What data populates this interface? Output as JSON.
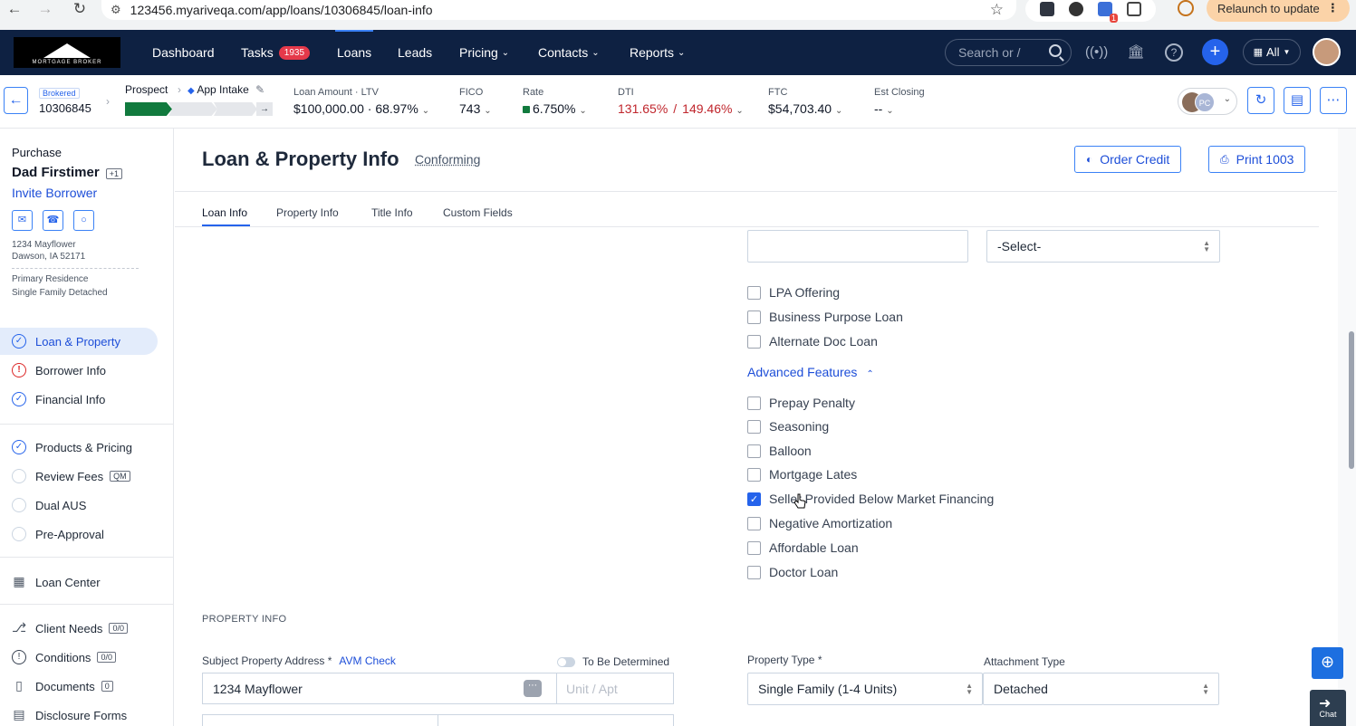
{
  "browser": {
    "url": "123456.myariveqa.com/app/loans/10306845/loan-info",
    "relaunch_label": "Relaunch to update",
    "ext_badge": "1"
  },
  "nav": {
    "logo_text": "MORTGAGE BROKER",
    "items": [
      {
        "label": "Dashboard"
      },
      {
        "label": "Tasks",
        "badge": "1935"
      },
      {
        "label": "Loans"
      },
      {
        "label": "Leads"
      },
      {
        "label": "Pricing"
      },
      {
        "label": "Contacts"
      },
      {
        "label": "Reports"
      }
    ],
    "search_placeholder": "Search or /",
    "scope_label": "All",
    "active_item": "Loans"
  },
  "loanbar": {
    "brokered_tag": "Brokered",
    "loan_number": "10306845",
    "stage": "Prospect",
    "substage": "App Intake",
    "loan_amount_label": "Loan Amount",
    "ltv_label": "LTV",
    "loan_amount": "$100,000.00",
    "ltv": "68.97%",
    "fico_label": "FICO",
    "fico": "743",
    "rate_label": "Rate",
    "rate": "6.750%",
    "dti_label": "DTI",
    "dti_front": "131.65%",
    "dti_sep": "/",
    "dti_back": "149.46%",
    "ftc_label": "FTC",
    "ftc": "$54,703.40",
    "est_closing_label": "Est Closing",
    "est_closing": "--",
    "avatar_initials": "PC",
    "progress_done_fraction": 0.33
  },
  "sidebar": {
    "purpose": "Purchase",
    "borrower": "Dad Firstimer",
    "borrower_extra": "+1",
    "invite": "Invite Borrower",
    "address1": "1234 Mayflower",
    "address2": "Dawson, IA 52171",
    "occupancy": "Primary Residence",
    "property_type": "Single Family Detached",
    "items": [
      {
        "label": "Loan & Property",
        "status": "ok"
      },
      {
        "label": "Borrower Info",
        "status": "err"
      },
      {
        "label": "Financial Info",
        "status": "ok"
      },
      {
        "label": "Products & Pricing",
        "status": "ok"
      },
      {
        "label": "Review Fees",
        "status": "empty",
        "chip": "QM"
      },
      {
        "label": "Dual AUS",
        "status": "empty"
      },
      {
        "label": "Pre-Approval",
        "status": "empty"
      },
      {
        "label": "Loan Center",
        "status": "plain"
      },
      {
        "label": "Client Needs",
        "chip": "0/0"
      },
      {
        "label": "Conditions",
        "chip": "0/0"
      },
      {
        "label": "Documents",
        "chip": "0"
      },
      {
        "label": "Disclosure Forms"
      }
    ]
  },
  "main": {
    "title": "Loan & Property Info",
    "subtitle": "Conforming",
    "order_credit": "Order Credit",
    "print": "Print 1003",
    "tabs": [
      "Loan Info",
      "Property Info",
      "Title Info",
      "Custom Fields"
    ],
    "select_placeholder": "-Select-",
    "checkboxes_top": [
      {
        "label": "LPA Offering",
        "checked": false
      },
      {
        "label": "Business Purpose Loan",
        "checked": false
      },
      {
        "label": "Alternate Doc Loan",
        "checked": false
      }
    ],
    "advanced_features": "Advanced Features",
    "checkboxes_adv": [
      {
        "label": "Prepay Penalty",
        "checked": false
      },
      {
        "label": "Seasoning",
        "checked": false
      },
      {
        "label": "Balloon",
        "checked": false
      },
      {
        "label": "Mortgage Lates",
        "checked": false
      },
      {
        "label": "Seller Provided Below Market Financing",
        "checked": true
      },
      {
        "label": "Negative Amortization",
        "checked": false
      },
      {
        "label": "Affordable Loan",
        "checked": false
      },
      {
        "label": "Doctor Loan",
        "checked": false
      }
    ],
    "property_section": "PROPERTY INFO",
    "subject_address_label": "Subject Property Address *",
    "avm_check": "AVM Check",
    "tbd_label": "To Be Determined",
    "address_value": "1234 Mayflower",
    "unit_placeholder": "Unit / Apt",
    "property_type_label": "Property Type *",
    "property_type_value": "Single Family (1-4 Units)",
    "attachment_label": "Attachment Type",
    "attachment_value": "Detached",
    "chat_label": "Chat"
  },
  "colors": {
    "nav_bg": "#0e2142",
    "accent": "#2563eb",
    "danger": "#c0262d",
    "progress_green": "#117a3e"
  }
}
